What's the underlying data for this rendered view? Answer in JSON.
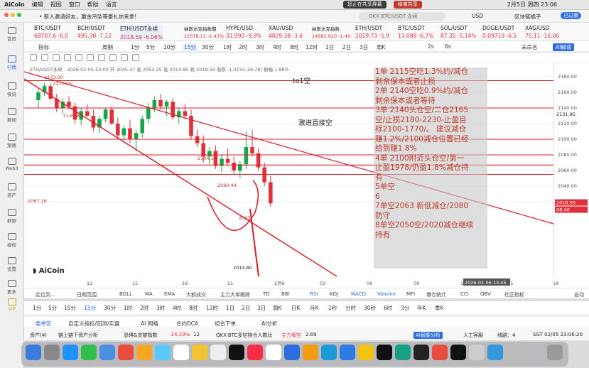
{
  "menubar": {
    "app": "AiCoin",
    "items": [
      "编辑",
      "视图",
      "窗口",
      "帮助",
      "语言"
    ],
    "share_status": "您正在共享屏幕",
    "end_share": "结束共享",
    "datetime": "2月5日 周四  23:06"
  },
  "topbar": {
    "notice": "• 新人邀请好友，赢金吊坠等豪礼你来拿!",
    "search_placeholder": "OKX BTC/USDT 永续",
    "currency": "USD",
    "user": "区块链橘子",
    "ticket": "已过期"
  },
  "sidebar": [
    {
      "label": "首页",
      "icon": "home-icon"
    },
    {
      "label": "行情",
      "icon": "candle-icon"
    },
    {
      "label": "快讯",
      "icon": "flash-icon"
    },
    {
      "label": "要闻",
      "icon": "news-icon"
    },
    {
      "label": "策略",
      "icon": "strategy-icon"
    },
    {
      "label": "Web3",
      "icon": "web3-icon"
    },
    {
      "label": "资产",
      "icon": "asset-icon"
    },
    {
      "label": "群聊",
      "icon": "chat-icon"
    },
    {
      "label": "授权",
      "icon": "auth-icon"
    },
    {
      "label": "设置",
      "icon": "gear-icon"
    },
    {
      "label": "更多",
      "icon": "more-icon"
    },
    {
      "label": "VIP",
      "icon": "vip-icon"
    }
  ],
  "tickers": [
    {
      "name": "BTC/USDT",
      "value": "68707.6",
      "change": "-6.0"
    },
    {
      "name": "BCH/USDT",
      "value": "495.30",
      "change": "-7.12"
    },
    {
      "name": "ETH/USDT永续",
      "value": "2018.59",
      "change": "-6.06%"
    },
    {
      "name": "纳斯达克指数期",
      "value": "22578.11",
      "change": "-1.43%"
    },
    {
      "name": "HYPE/USD",
      "value": "31.992",
      "change": "-9.9%"
    },
    {
      "name": "XAU/USD",
      "value": "4829.38",
      "change": "-3.6"
    },
    {
      "name": "纳斯达克指数",
      "value": "24682.820",
      "change": "-1.49"
    },
    {
      "name": "ETH/USDT",
      "value": "2019.73",
      "change": "-5.9"
    },
    {
      "name": "BTC/USDT",
      "value": "13.088",
      "change": "-6.7%"
    },
    {
      "name": "SOL/USDT",
      "value": "87.35",
      "change": "-5.14%"
    },
    {
      "name": "DOGE/USDT",
      "value": "0.09710",
      "change": "-6.5"
    },
    {
      "name": "XAG/USD",
      "value": "75.11",
      "change": "-16.06"
    }
  ],
  "toolbar1": {
    "items": [
      "指标",
      "周期",
      "1分",
      "5分",
      "10分",
      "15分",
      "30分",
      "1时",
      "2时",
      "3时",
      "4时",
      "8时",
      "12时",
      "1日",
      "2日",
      "3日",
      "周K",
      "2s",
      "6s"
    ],
    "right": [
      "未命名",
      "AI解读"
    ]
  },
  "chart": {
    "symbol_line": "ETH/USDT永续 · 2026-02-05 23:00  开 2045.37  高 2053.25  低 2014.80  收 2018.59  涨跌 -1.31%(-26.78)  振幅 1.88%",
    "price_labels": [
      "2173.00",
      "2172.00",
      "2140.62",
      "2104.11",
      "2080.44",
      "2067.16",
      "2063",
      "2014.80",
      "to1空",
      "激进直接空"
    ],
    "price_axis": [
      "2180.00",
      "2160.00",
      "2140.00",
      "2120.00",
      "2100.00",
      "2080.00",
      "2060.00",
      "2040.00",
      "2020.00"
    ],
    "current_price": "2131.85",
    "last_price": "2018.59",
    "countdown": "08:40",
    "time_axis": [
      "12",
      "15",
      "18",
      "21",
      "2月6",
      "03",
      "06",
      "09",
      "12",
      "15",
      "18"
    ],
    "time_tag": "2026-02-06 13:45",
    "watermark": "AiCoin",
    "notes": [
      "1单 2115空吃1.3%约/减仓",
      "剩余保本或者止损",
      "2单 2140空吃0.9%约/减仓",
      "剩余保本或者等待",
      "3单 2140头仓空/二仓2165",
      "空/止损2180-2230-止盈目",
      "标2100-1770/。 建议减仓",
      "赚1.2%/2100减仓位置已经",
      "给到赚1.8%",
      "4单  2100附近头仓空/第一",
      "止盈1978/仍盈1.8%减仓持",
      "有",
      "5单空",
      "6",
      "7单空2063  新低减仓/2080",
      "防守",
      "8单空2050空/2020减仓继续",
      "持有"
    ]
  },
  "indicators": {
    "left": [
      "定位到...",
      "日期范围"
    ],
    "items": [
      "BOLL",
      "MA",
      "EMA",
      "大额成交",
      "主力大单跟踪",
      "TD",
      "BBI",
      "RSI",
      "KDJ",
      "MACD",
      "Volume",
      "MFI",
      "爆仓统计",
      "CCI",
      "OBV",
      "社区指标",
      "自动"
    ]
  },
  "periods": [
    "1分",
    "5分",
    "10分",
    "15分",
    "30分",
    "1时",
    "2时",
    "3时",
    "4时",
    "8时",
    "12时",
    "1日",
    "2日",
    "3日",
    "周K",
    "日K",
    "月K",
    "1秒",
    "分时",
    "30秒",
    "6时",
    "3分",
    "年K",
    "季K"
  ],
  "bottom_tabs": [
    "委单区",
    "自定义指标/回测/实盘",
    "AI 网格",
    "合约DCA",
    "组合下单",
    "AI分析"
  ],
  "status": {
    "asset": "资产(¥)",
    "chain": "链上链下资产分析",
    "fear": "恐惧&贪婪指数",
    "fear_val": "-14.29%",
    "fear_num": "12",
    "flow": "OKX-BTC多空持仓人数比",
    "force": "主力看空",
    "force_val": "2.69",
    "ai": "AI智能分析",
    "service": "人工客服",
    "line": "线路：4",
    "sgt": "SGT 02/05 23:06:20"
  },
  "colors": {
    "bull": "#17a74a",
    "bear": "#e0313b",
    "accent": "#2d6be4",
    "trendline": "#d81e2a"
  }
}
